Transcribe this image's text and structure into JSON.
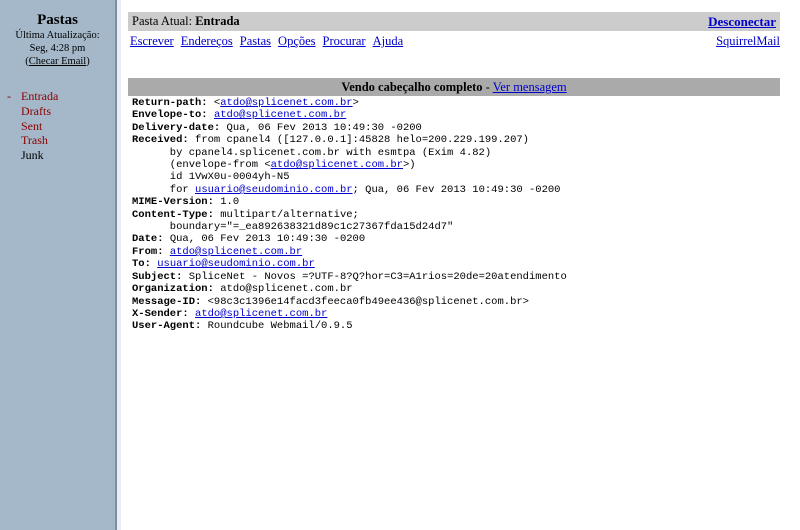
{
  "sidebar": {
    "title": "Pastas",
    "last_update_label": "Última Atualização:",
    "last_update_time": "Seg, 4:28 pm",
    "check_mail": "Checar Email",
    "folders": [
      {
        "name": "Entrada",
        "current": true
      },
      {
        "name": "Drafts",
        "current": false
      },
      {
        "name": "Sent",
        "current": false
      },
      {
        "name": "Trash",
        "current": false
      },
      {
        "name": "Junk",
        "current": false
      }
    ],
    "current_marker": "-"
  },
  "top": {
    "current_folder_label": "Pasta Atual:",
    "current_folder": "Entrada",
    "logout": "Desconectar"
  },
  "nav": {
    "items": [
      "Escrever",
      "Endereços",
      "Pastas",
      "Opções",
      "Procurar",
      "Ajuda"
    ],
    "brand_link": "SquirrelMail"
  },
  "header_view": {
    "title": "Vendo cabeçalho completo",
    "sep": " - ",
    "view_message": "Ver mensagem"
  },
  "headers": [
    {
      "key": "Return-path:",
      "parts": [
        {
          "t": " <"
        },
        {
          "l": "atdo@splicenet.com.br"
        },
        {
          "t": ">"
        }
      ]
    },
    {
      "key": "Envelope-to:",
      "parts": [
        {
          "t": " "
        },
        {
          "l": "atdo@splicenet.com.br"
        }
      ]
    },
    {
      "key": "Delivery-date:",
      "parts": [
        {
          "t": " Qua, 06 Fev 2013 10:49:30 -0200"
        }
      ]
    },
    {
      "key": "Received:",
      "parts": [
        {
          "t": " from cpanel4 ([127.0.0.1]:45828 helo=200.229.199.207)"
        }
      ]
    },
    {
      "key": "",
      "parts": [
        {
          "t": "      by cpanel4.splicenet.com.br with esmtpa (Exim 4.82)"
        }
      ]
    },
    {
      "key": "",
      "parts": [
        {
          "t": "      (envelope-from <"
        },
        {
          "l": "atdo@splicenet.com.br"
        },
        {
          "t": ">)"
        }
      ]
    },
    {
      "key": "",
      "parts": [
        {
          "t": "      id 1VwX0u-0004yh-N5"
        }
      ]
    },
    {
      "key": "",
      "parts": [
        {
          "t": "      for "
        },
        {
          "l": "usuario@seudominio.com.br"
        },
        {
          "t": "; Qua, 06 Fev 2013 10:49:30 -0200"
        }
      ]
    },
    {
      "key": "MIME-Version:",
      "parts": [
        {
          "t": " 1.0"
        }
      ]
    },
    {
      "key": "Content-Type:",
      "parts": [
        {
          "t": " multipart/alternative;"
        }
      ]
    },
    {
      "key": "",
      "parts": [
        {
          "t": "      boundary=\"=_ea892638321d89c1c27367fda15d24d7\""
        }
      ]
    },
    {
      "key": "Date:",
      "parts": [
        {
          "t": " Qua, 06 Fev 2013 10:49:30 -0200"
        }
      ]
    },
    {
      "key": "From:",
      "parts": [
        {
          "t": " "
        },
        {
          "l": "atdo@splicenet.com.br"
        }
      ]
    },
    {
      "key": "To:",
      "parts": [
        {
          "t": " "
        },
        {
          "l": "usuario@seudominio.com.br"
        }
      ]
    },
    {
      "key": "Subject:",
      "parts": [
        {
          "t": " SpliceNet - Novos =?UTF-8?Q?hor=C3=A1rios=20de=20atendimento"
        }
      ]
    },
    {
      "key": "Organization:",
      "parts": [
        {
          "t": " atdo@splicenet.com.br"
        }
      ]
    },
    {
      "key": "Message-ID:",
      "parts": [
        {
          "t": " <98c3c1396e14facd3feeca0fb49ee436@splicenet.com.br>"
        }
      ]
    },
    {
      "key": "X-Sender:",
      "parts": [
        {
          "t": " "
        },
        {
          "l": "atdo@splicenet.com.br"
        }
      ]
    },
    {
      "key": "User-Agent:",
      "parts": [
        {
          "t": " Roundcube Webmail/0.9.5"
        }
      ]
    }
  ]
}
